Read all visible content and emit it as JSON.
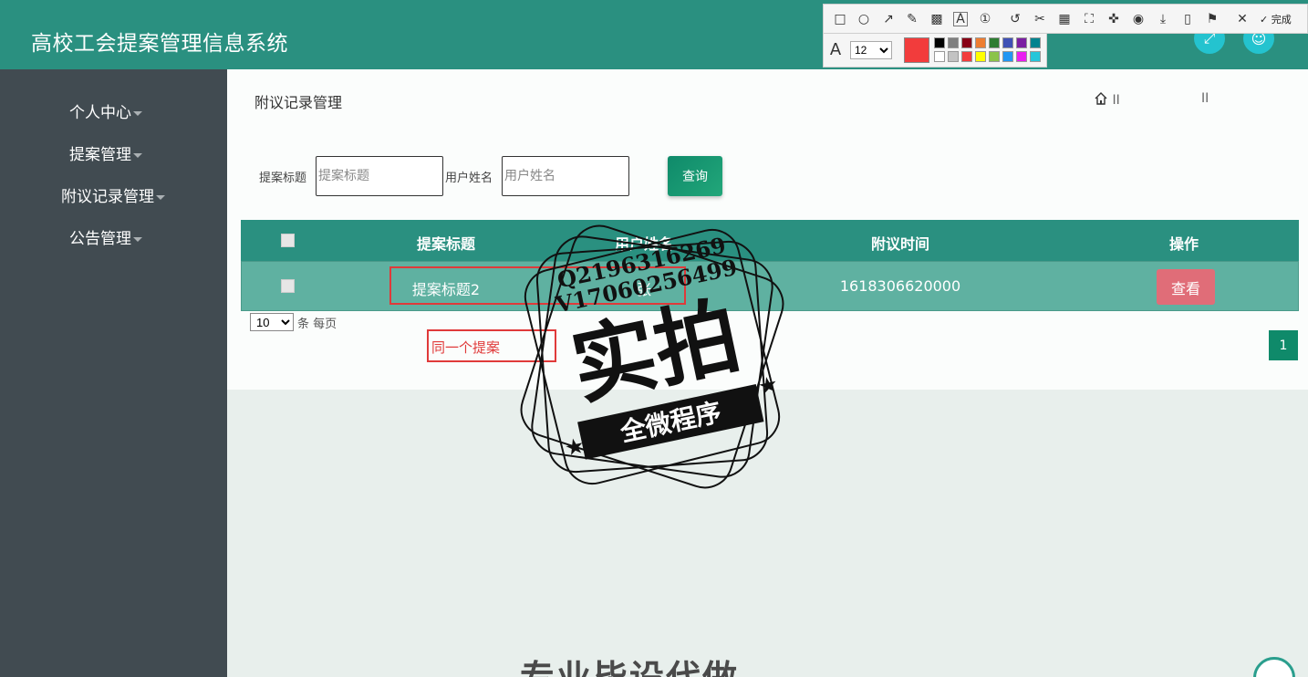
{
  "header": {
    "title": "高校工会提案管理信息系统"
  },
  "sidebar": {
    "items": [
      {
        "label": "个人中心"
      },
      {
        "label": "提案管理"
      },
      {
        "label": "附议记录管理"
      },
      {
        "label": "公告管理"
      }
    ]
  },
  "page": {
    "title": "附议记录管理",
    "breadcrumb_sep": "II"
  },
  "search": {
    "title_label": "提案标题",
    "title_placeholder": "提案标题",
    "user_label": "用户姓名",
    "user_placeholder": "用户姓名",
    "query_button": "查询"
  },
  "table": {
    "headers": [
      "提案标题",
      "用户姓名",
      "附议时间",
      "操作"
    ],
    "rows": [
      {
        "title": "提案标题2",
        "user": "张",
        "time": "1618306620000",
        "action": "查看"
      }
    ]
  },
  "pager": {
    "page_size": "10",
    "per_page_text": "条 每页",
    "current_page": "1"
  },
  "annotation": {
    "text": "同一个提案"
  },
  "toolbar": {
    "font_size": "12",
    "done_label": "完成",
    "current_color": "#f23c3c",
    "colors": [
      "#000000",
      "#7f7f7f",
      "#880015",
      "#ed7d31",
      "#2e7d32",
      "#3f51b5",
      "#7b1fa2",
      "#00838f",
      "#ffffff",
      "#c3c3c3",
      "#f23c3c",
      "#ffff00",
      "#8bc34a",
      "#2196f3",
      "#e91ef0",
      "#26c6da"
    ]
  },
  "watermark": {
    "contact1": "Q2196316269",
    "contact2": "V17060256499",
    "main": "实拍",
    "sub": "全微程序"
  },
  "footer": {
    "big_text": "专业毕设代做"
  }
}
